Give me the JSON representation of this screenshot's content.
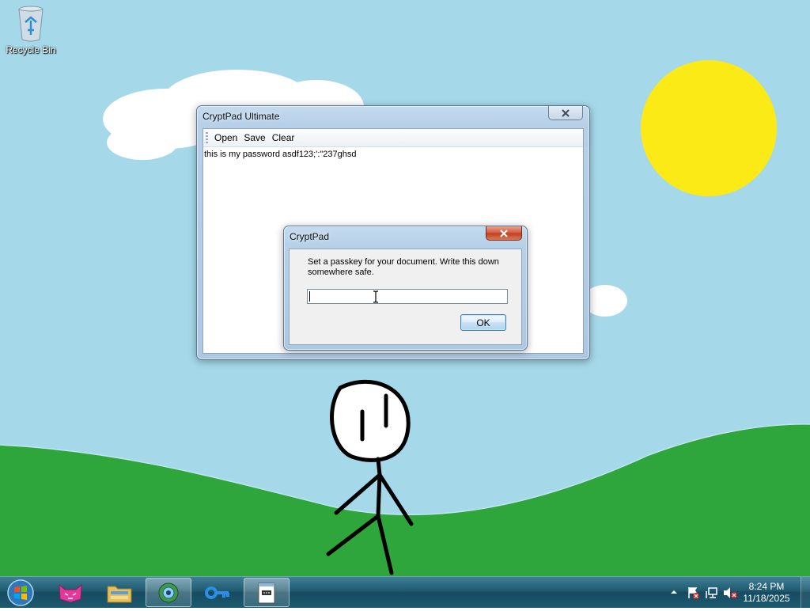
{
  "desktop": {
    "icons": [
      {
        "label": "Recycle Bin",
        "icon": "recycle-bin-icon"
      }
    ]
  },
  "main_window": {
    "title": "CryptPad Ultimate",
    "menu": [
      "Open",
      "Save",
      "Clear"
    ],
    "document_text": "this is my password asdf123;':\"237ghsd"
  },
  "dialog": {
    "title": "CryptPad",
    "message": "Set a passkey for your document. Write this down somewhere safe.",
    "input_value": "",
    "ok_label": "OK"
  },
  "taskbar": {
    "pinned": [
      {
        "name": "start-button",
        "icon": "windows-orb-icon"
      },
      {
        "name": "cat-app",
        "icon": "pink-cat-icon"
      },
      {
        "name": "file-explorer",
        "icon": "folder-icon"
      },
      {
        "name": "media-app",
        "icon": "globe-media-icon",
        "active": true
      },
      {
        "name": "key-app",
        "icon": "key-icon"
      },
      {
        "name": "cryptpad",
        "icon": "notepad-icon",
        "active": true
      }
    ],
    "tray": {
      "icons": [
        "show-hidden-icon",
        "action-center-icon",
        "network-icon",
        "volume-muted-icon"
      ],
      "time": "8:24 PM",
      "date": "11/18/2025"
    }
  },
  "colors": {
    "sky": "#a5d9ea",
    "grass": "#2fa63b",
    "sun": "#fbea16",
    "taskbar": "#1f5a70"
  }
}
